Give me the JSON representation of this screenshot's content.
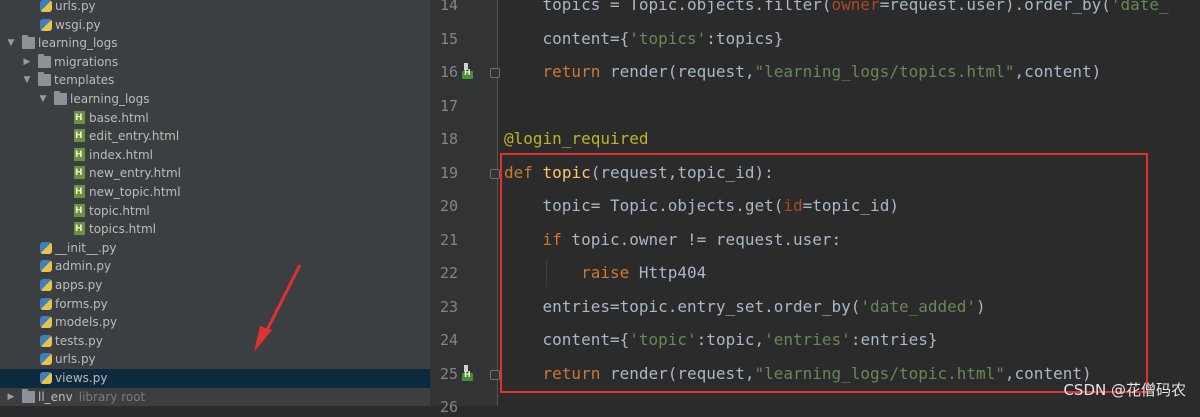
{
  "project_tree": {
    "items": [
      {
        "label": "urls.py",
        "type": "py",
        "level": 2
      },
      {
        "label": "wsgi.py",
        "type": "py",
        "level": 2
      },
      {
        "label": "learning_logs",
        "type": "folder",
        "level": 0,
        "expanded": true
      },
      {
        "label": "migrations",
        "type": "folder",
        "level": 1,
        "expanded": false
      },
      {
        "label": "templates",
        "type": "folder",
        "level": 1,
        "expanded": true
      },
      {
        "label": "learning_logs",
        "type": "folder",
        "level": 2,
        "expanded": true
      },
      {
        "label": "base.html",
        "type": "html",
        "level": 3
      },
      {
        "label": "edit_entry.html",
        "type": "html",
        "level": 3
      },
      {
        "label": "index.html",
        "type": "html",
        "level": 3
      },
      {
        "label": "new_entry.html",
        "type": "html",
        "level": 3
      },
      {
        "label": "new_topic.html",
        "type": "html",
        "level": 3
      },
      {
        "label": "topic.html",
        "type": "html",
        "level": 3
      },
      {
        "label": "topics.html",
        "type": "html",
        "level": 3
      },
      {
        "label": "__init__.py",
        "type": "py",
        "level": 2
      },
      {
        "label": "admin.py",
        "type": "py",
        "level": 2
      },
      {
        "label": "apps.py",
        "type": "py",
        "level": 2
      },
      {
        "label": "forms.py",
        "type": "py",
        "level": 2
      },
      {
        "label": "models.py",
        "type": "py",
        "level": 2
      },
      {
        "label": "tests.py",
        "type": "py",
        "level": 2
      },
      {
        "label": "urls.py",
        "type": "py",
        "level": 2
      },
      {
        "label": "views.py",
        "type": "py",
        "level": 2,
        "selected": true
      },
      {
        "label": "ll_env",
        "type": "folder",
        "level": 0,
        "expanded": false,
        "suffix": "library root"
      }
    ]
  },
  "editor": {
    "line_numbers": [
      "14",
      "15",
      "16",
      "17",
      "18",
      "19",
      "20",
      "21",
      "22",
      "23",
      "24",
      "25",
      "26"
    ],
    "lines": [
      "    topics = Topic.objects.filter(owner=request.user).order_by('date_",
      "    content={'topics':topics}",
      "    return render(request,\"learning_logs/topics.html\",content)",
      "",
      "@login_required",
      "def topic(request,topic_id):",
      "    topic= Topic.objects.get(id=topic_id)",
      "    if topic.owner != request.user:",
      "        raise Http404",
      "    entries=topic.entry_set.order_by('date_added')",
      "    content={'topic':topic,'entries':entries}",
      "    return render(request,\"learning_logs/topic.html\",content)",
      ""
    ]
  },
  "watermark": "CSDN @花僧码农",
  "colors": {
    "highlight_box": "#e03131",
    "selection": "#0d293e",
    "editor_bg": "#2b2b2b",
    "sidebar_bg": "#3c3f41"
  }
}
